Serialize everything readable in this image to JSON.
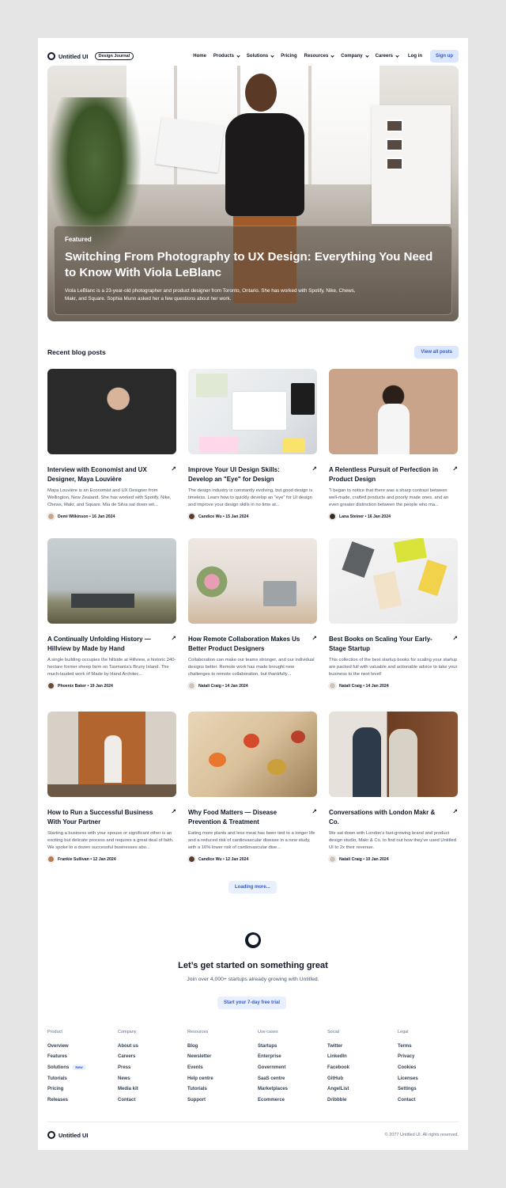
{
  "header": {
    "brand": "Untitled UI",
    "badge": "Design Journal",
    "nav": [
      {
        "label": "Home",
        "dropdown": false
      },
      {
        "label": "Products",
        "dropdown": true
      },
      {
        "label": "Solutions",
        "dropdown": true
      },
      {
        "label": "Pricing",
        "dropdown": false
      },
      {
        "label": "Resources",
        "dropdown": true
      },
      {
        "label": "Company",
        "dropdown": true
      },
      {
        "label": "Careers",
        "dropdown": true
      }
    ],
    "login": "Log in",
    "signup": "Sign up"
  },
  "hero": {
    "eyebrow": "Featured",
    "title": "Switching From Photography to UX Design: Everything You Need to Know With Viola LeBlanc",
    "description": "Viola LeBlanc is a 23-year-old photographer and product designer from Toronto, Ontario. She has worked with Spotify, Nike, Chews, Makr, and Square. Sophia Munn asked her a few questions about her work."
  },
  "recent": {
    "title": "Recent blog posts",
    "view_all": "View all posts",
    "posts": [
      {
        "title": "Interview with Economist and UX Designer, Maya Louvière",
        "desc": "Maya Louvière is an Economist and UX Designer from Wellington, New Zealand. She has worked with Spotify, Nike, Chews, Makr, and Square. Mia de Silva sat down wit...",
        "author": "Demi Wilkinson • 16 Jan 2024"
      },
      {
        "title": "Improve Your UI Design Skills: Develop an \"Eye\" for Design",
        "desc": "The design industry is constantly evolving, but good design is timeless. Learn how to quickly develop an \"eye\" for UI design and improve your design skills in no time at...",
        "author": "Candice Wu • 15 Jan 2024"
      },
      {
        "title": "A Relentless Pursuit of Perfection in Product Design",
        "desc": "\"I began to notice that there was a sharp contrast between well-made, crafted products and poorly made ones, and an even greater distinction between the people who ma...",
        "author": "Lana Steiner • 16 Jan 2024"
      },
      {
        "title": "A Continually Unfolding History — Hillview by Made by Hand",
        "desc": "A single building occupies the hillside at Hillview, a historic 240-hectare former sheep farm on Tasmania's Bruny Island. The much-lauded work of Made by Hand Architec...",
        "author": "Phoenix Baker • 19 Jan 2024"
      },
      {
        "title": "How Remote Collaboration Makes Us Better Product Designers",
        "desc": "Collaboration can make our teams stronger, and our individual designs better. Remote work has made brought new challenges to remote collaboration, but thankfully...",
        "author": "Natali Craig • 14 Jan 2024"
      },
      {
        "title": "Best Books on Scaling Your Early-Stage Startup",
        "desc": "This collection of the best startup books for scaling your startup are packed full with valuable and actionable advice to take your business to the next level!",
        "author": "Natali Craig • 14 Jan 2024"
      },
      {
        "title": "How to Run a Successful Business With Your Partner",
        "desc": "Starting a business with your spouse or significant other is an exciting but delicate process and requires a great deal of faith. We spoke to a dozen successful businesses abo...",
        "author": "Frankie Sullivan • 12 Jan 2024"
      },
      {
        "title": "Why Food Matters — Disease Prevention & Treatment",
        "desc": "Eating more plants and less meat has been tied to a longer life and a reduced risk of cardiovascular disease in a new study, with a 16% lower risk of cardiovascular dise...",
        "author": "Candice Wu • 12 Jan 2024"
      },
      {
        "title": "Conversations with London Makr & Co.",
        "desc": "We sat down with London's fast-growing brand and product design studio, Makr & Co. to find out how they've used Untitled UI to 2x their revenue.",
        "author": "Natali Craig • 10 Jan 2024"
      }
    ],
    "loading": "Loading more..."
  },
  "cta": {
    "title": "Let’s get started on something great",
    "subtitle": "Join over 4,000+ startups already growing with Untitled.",
    "button": "Start your 7-day free trial"
  },
  "footer": {
    "columns": [
      {
        "heading": "Product",
        "links": [
          "Overview",
          "Features",
          "Solutions",
          "Tutorials",
          "Pricing",
          "Releases"
        ]
      },
      {
        "heading": "Company",
        "links": [
          "About us",
          "Careers",
          "Press",
          "News",
          "Media kit",
          "Contact"
        ]
      },
      {
        "heading": "Resources",
        "links": [
          "Blog",
          "Newsletter",
          "Events",
          "Help centre",
          "Tutorials",
          "Support"
        ]
      },
      {
        "heading": "Use cases",
        "links": [
          "Startups",
          "Enterprise",
          "Government",
          "SaaS centre",
          "Marketplaces",
          "Ecommerce"
        ]
      },
      {
        "heading": "Social",
        "links": [
          "Twitter",
          "LinkedIn",
          "Facebook",
          "GitHub",
          "AngelList",
          "Dribbble"
        ]
      },
      {
        "heading": "Legal",
        "links": [
          "Terms",
          "Privacy",
          "Cookies",
          "Licenses",
          "Settings",
          "Contact"
        ]
      }
    ],
    "new_badge": "New",
    "brand": "Untitled UI",
    "copyright": "© 2077 Untitled UI. All rights reserved."
  },
  "colors": {
    "accent": "#2e5bd6",
    "accent_bg": "#dbe7ff",
    "text": "#101828",
    "muted": "#475467"
  }
}
